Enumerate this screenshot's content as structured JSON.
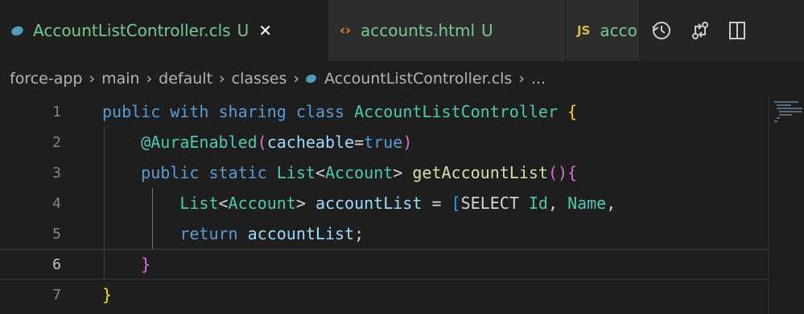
{
  "tabs": [
    {
      "label": "AccountListController.cls",
      "status": "U",
      "close": "✕",
      "active": true
    },
    {
      "label": "accounts.html",
      "status": "U",
      "active": false
    },
    {
      "label": "acco",
      "badge": "JS",
      "active": false
    }
  ],
  "actions": [
    "timeline-icon",
    "compare-changes-icon",
    "split-editor-icon"
  ],
  "breadcrumb": [
    "force-app",
    "main",
    "default",
    "classes",
    "AccountListController.cls",
    "..."
  ],
  "lines": [
    {
      "num": "1"
    },
    {
      "num": "2"
    },
    {
      "num": "3"
    },
    {
      "num": "4"
    },
    {
      "num": "5"
    },
    {
      "num": "6"
    },
    {
      "num": "7"
    }
  ],
  "code": {
    "l1": {
      "k1": "public",
      "k2": "with",
      "k3": "sharing",
      "k4": "class",
      "cls": "AccountListController",
      "brace": "{"
    },
    "l2": {
      "ann": "@AuraEnabled",
      "p1": "(",
      "id": "cacheable",
      "eq": "=",
      "val": "true",
      "p2": ")"
    },
    "l3": {
      "k1": "public",
      "k2": "static",
      "t1": "List",
      "lt": "<",
      "t2": "Account",
      "gt": ">",
      "fn": "getAccountList",
      "p": "()",
      "brace": "{"
    },
    "l4": {
      "t1": "List",
      "lt": "<",
      "t2": "Account",
      "gt": ">",
      "var": "accountList",
      "eq": "=",
      "br": "[",
      "sel": "SELECT",
      "f1": "Id",
      "c1": ",",
      "f2": "Name",
      "c2": ","
    },
    "l5": {
      "kw": "return",
      "var": "accountList",
      "semi": ";"
    },
    "l6": {
      "brace": "}"
    },
    "l7": {
      "brace": "}"
    }
  },
  "colors": {
    "accent": "#73c991",
    "keyword": "#569cd6",
    "type": "#4ec9b0",
    "function": "#dcdcaa",
    "variable": "#9cdcfe"
  }
}
